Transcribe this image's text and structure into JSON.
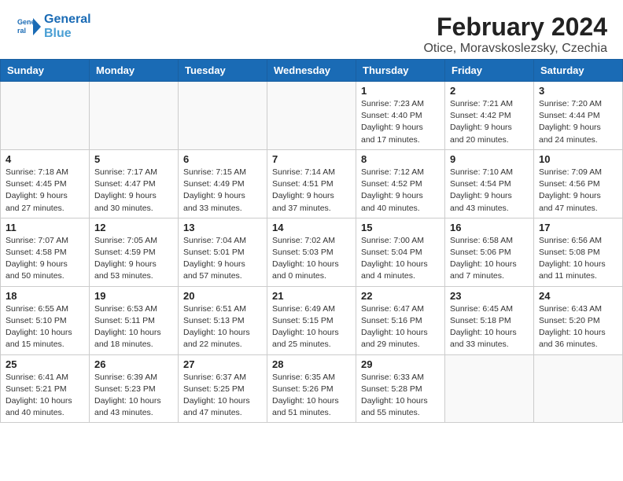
{
  "header": {
    "logo_line1": "General",
    "logo_line2": "Blue",
    "title": "February 2024",
    "subtitle": "Otice, Moravskoslezsky, Czechia"
  },
  "weekdays": [
    "Sunday",
    "Monday",
    "Tuesday",
    "Wednesday",
    "Thursday",
    "Friday",
    "Saturday"
  ],
  "weeks": [
    [
      {
        "day": "",
        "info": "",
        "empty": true
      },
      {
        "day": "",
        "info": "",
        "empty": true
      },
      {
        "day": "",
        "info": "",
        "empty": true
      },
      {
        "day": "",
        "info": "",
        "empty": true
      },
      {
        "day": "1",
        "info": "Sunrise: 7:23 AM\nSunset: 4:40 PM\nDaylight: 9 hours\nand 17 minutes."
      },
      {
        "day": "2",
        "info": "Sunrise: 7:21 AM\nSunset: 4:42 PM\nDaylight: 9 hours\nand 20 minutes."
      },
      {
        "day": "3",
        "info": "Sunrise: 7:20 AM\nSunset: 4:44 PM\nDaylight: 9 hours\nand 24 minutes."
      }
    ],
    [
      {
        "day": "4",
        "info": "Sunrise: 7:18 AM\nSunset: 4:45 PM\nDaylight: 9 hours\nand 27 minutes."
      },
      {
        "day": "5",
        "info": "Sunrise: 7:17 AM\nSunset: 4:47 PM\nDaylight: 9 hours\nand 30 minutes."
      },
      {
        "day": "6",
        "info": "Sunrise: 7:15 AM\nSunset: 4:49 PM\nDaylight: 9 hours\nand 33 minutes."
      },
      {
        "day": "7",
        "info": "Sunrise: 7:14 AM\nSunset: 4:51 PM\nDaylight: 9 hours\nand 37 minutes."
      },
      {
        "day": "8",
        "info": "Sunrise: 7:12 AM\nSunset: 4:52 PM\nDaylight: 9 hours\nand 40 minutes."
      },
      {
        "day": "9",
        "info": "Sunrise: 7:10 AM\nSunset: 4:54 PM\nDaylight: 9 hours\nand 43 minutes."
      },
      {
        "day": "10",
        "info": "Sunrise: 7:09 AM\nSunset: 4:56 PM\nDaylight: 9 hours\nand 47 minutes."
      }
    ],
    [
      {
        "day": "11",
        "info": "Sunrise: 7:07 AM\nSunset: 4:58 PM\nDaylight: 9 hours\nand 50 minutes."
      },
      {
        "day": "12",
        "info": "Sunrise: 7:05 AM\nSunset: 4:59 PM\nDaylight: 9 hours\nand 53 minutes."
      },
      {
        "day": "13",
        "info": "Sunrise: 7:04 AM\nSunset: 5:01 PM\nDaylight: 9 hours\nand 57 minutes."
      },
      {
        "day": "14",
        "info": "Sunrise: 7:02 AM\nSunset: 5:03 PM\nDaylight: 10 hours\nand 0 minutes."
      },
      {
        "day": "15",
        "info": "Sunrise: 7:00 AM\nSunset: 5:04 PM\nDaylight: 10 hours\nand 4 minutes."
      },
      {
        "day": "16",
        "info": "Sunrise: 6:58 AM\nSunset: 5:06 PM\nDaylight: 10 hours\nand 7 minutes."
      },
      {
        "day": "17",
        "info": "Sunrise: 6:56 AM\nSunset: 5:08 PM\nDaylight: 10 hours\nand 11 minutes."
      }
    ],
    [
      {
        "day": "18",
        "info": "Sunrise: 6:55 AM\nSunset: 5:10 PM\nDaylight: 10 hours\nand 15 minutes."
      },
      {
        "day": "19",
        "info": "Sunrise: 6:53 AM\nSunset: 5:11 PM\nDaylight: 10 hours\nand 18 minutes."
      },
      {
        "day": "20",
        "info": "Sunrise: 6:51 AM\nSunset: 5:13 PM\nDaylight: 10 hours\nand 22 minutes."
      },
      {
        "day": "21",
        "info": "Sunrise: 6:49 AM\nSunset: 5:15 PM\nDaylight: 10 hours\nand 25 minutes."
      },
      {
        "day": "22",
        "info": "Sunrise: 6:47 AM\nSunset: 5:16 PM\nDaylight: 10 hours\nand 29 minutes."
      },
      {
        "day": "23",
        "info": "Sunrise: 6:45 AM\nSunset: 5:18 PM\nDaylight: 10 hours\nand 33 minutes."
      },
      {
        "day": "24",
        "info": "Sunrise: 6:43 AM\nSunset: 5:20 PM\nDaylight: 10 hours\nand 36 minutes."
      }
    ],
    [
      {
        "day": "25",
        "info": "Sunrise: 6:41 AM\nSunset: 5:21 PM\nDaylight: 10 hours\nand 40 minutes."
      },
      {
        "day": "26",
        "info": "Sunrise: 6:39 AM\nSunset: 5:23 PM\nDaylight: 10 hours\nand 43 minutes."
      },
      {
        "day": "27",
        "info": "Sunrise: 6:37 AM\nSunset: 5:25 PM\nDaylight: 10 hours\nand 47 minutes."
      },
      {
        "day": "28",
        "info": "Sunrise: 6:35 AM\nSunset: 5:26 PM\nDaylight: 10 hours\nand 51 minutes."
      },
      {
        "day": "29",
        "info": "Sunrise: 6:33 AM\nSunset: 5:28 PM\nDaylight: 10 hours\nand 55 minutes."
      },
      {
        "day": "",
        "info": "",
        "empty": true
      },
      {
        "day": "",
        "info": "",
        "empty": true
      }
    ]
  ]
}
